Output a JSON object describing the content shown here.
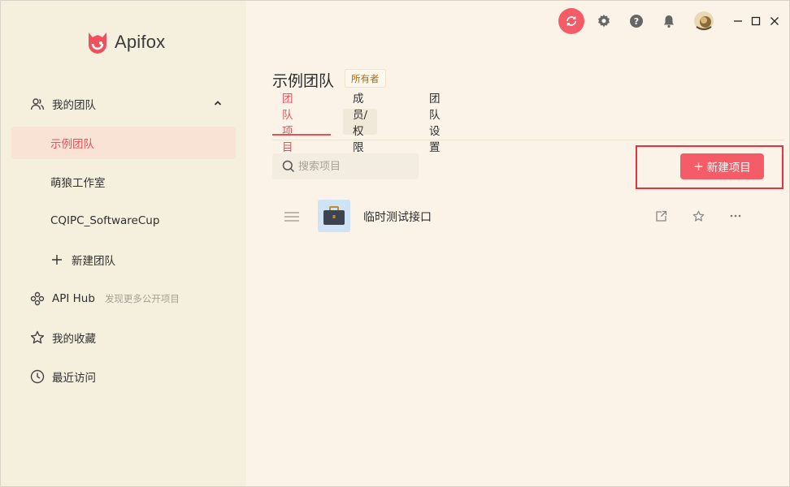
{
  "app": {
    "name": "Apifox"
  },
  "sidebar": {
    "teams_section": {
      "label": "我的团队"
    },
    "teams": [
      {
        "label": "示例团队",
        "active": true
      },
      {
        "label": "萌狼工作室"
      },
      {
        "label": "CQIPC_SoftwareCup"
      }
    ],
    "new_team": {
      "label": "新建团队"
    },
    "api_hub": {
      "label": "API Hub",
      "hint": "发现更多公开项目"
    },
    "favorites": {
      "label": "我的收藏"
    },
    "recent": {
      "label": "最近访问"
    }
  },
  "header": {
    "title": "示例团队",
    "badge": "所有者"
  },
  "tabs": [
    {
      "label": "团队项目",
      "active": true
    },
    {
      "label": "成员/权限"
    },
    {
      "label": "团队设置"
    }
  ],
  "search": {
    "placeholder": "搜索项目"
  },
  "toolbar": {
    "new_project_label": "新建项目",
    "plus": "+"
  },
  "projects": [
    {
      "name": "临时测试接口"
    }
  ],
  "colors": {
    "accent": "#f45d68",
    "active_text": "#e8515c",
    "sidebar_bg": "#f5efde",
    "main_bg": "#fbf3e8",
    "highlight": "#e5323c"
  },
  "icons": {
    "logo": "apifox-logo",
    "sync": "sync-icon",
    "settings": "gear-icon",
    "help": "help-icon",
    "notifications": "bell-icon",
    "avatar": "avatar",
    "minimize": "minimize-icon",
    "maximize": "maximize-icon",
    "close": "close-icon"
  }
}
